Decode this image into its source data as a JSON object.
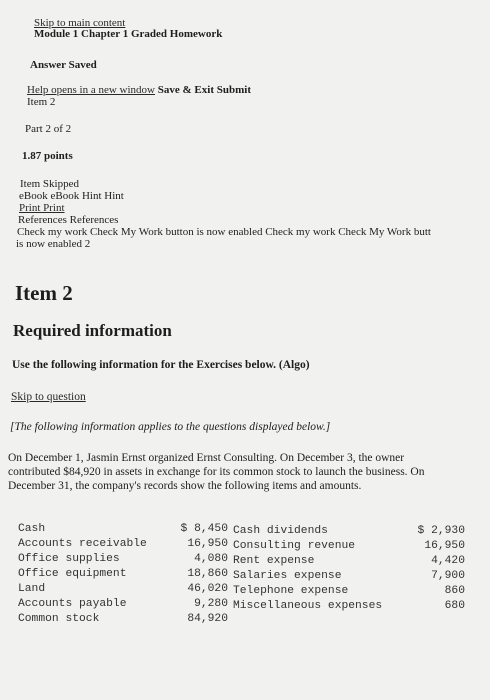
{
  "nav": {
    "skip_main": "Skip to main content",
    "title": "Module 1 Chapter 1 Graded Homework",
    "answer_saved": "Answer Saved",
    "help_link": "Help opens in a new window",
    "save_exit": "Save & Exit",
    "submit": "Submit",
    "item": "Item 2",
    "part": "Part 2 of 2",
    "points": "1.87 points",
    "item_skipped": "Item Skipped",
    "ebook": "eBook eBook",
    "hint": "Hint Hint",
    "print": "Print Print",
    "references": "References References",
    "check_line1": "Check my work Check My Work button is now enabled Check my work Check My Work butt",
    "check_line2": "is now enabled 2"
  },
  "content": {
    "item_heading": "Item 2",
    "required_heading": "Required information",
    "instruction": "Use the following information for the Exercises below. (Algo)",
    "skip_question": "Skip to question",
    "applies_note": "[The following information applies to the questions displayed below.]",
    "body_line1": "On December 1, Jasmin Ernst organized Ernst Consulting. On December 3, the owner",
    "body_line2": "contributed $84,920 in assets in exchange for its common stock to launch the business. On",
    "body_line3": "December 31, the company's records show the following items and amounts."
  },
  "table": {
    "left": [
      {
        "label": "Cash",
        "amount": "$ 8,450"
      },
      {
        "label": "Accounts receivable",
        "amount": "16,950"
      },
      {
        "label": "Office supplies",
        "amount": "4,080"
      },
      {
        "label": "Office equipment",
        "amount": "18,860"
      },
      {
        "label": "Land",
        "amount": "46,020"
      },
      {
        "label": "Accounts payable",
        "amount": "9,280"
      },
      {
        "label": "Common stock",
        "amount": "84,920"
      }
    ],
    "right": [
      {
        "label": "Cash dividends",
        "amount": "$ 2,930"
      },
      {
        "label": "Consulting revenue",
        "amount": "16,950"
      },
      {
        "label": "Rent expense",
        "amount": "4,420"
      },
      {
        "label": "Salaries expense",
        "amount": "7,900"
      },
      {
        "label": "Telephone expense",
        "amount": "860"
      },
      {
        "label": "Miscellaneous expenses",
        "amount": "680"
      }
    ]
  }
}
